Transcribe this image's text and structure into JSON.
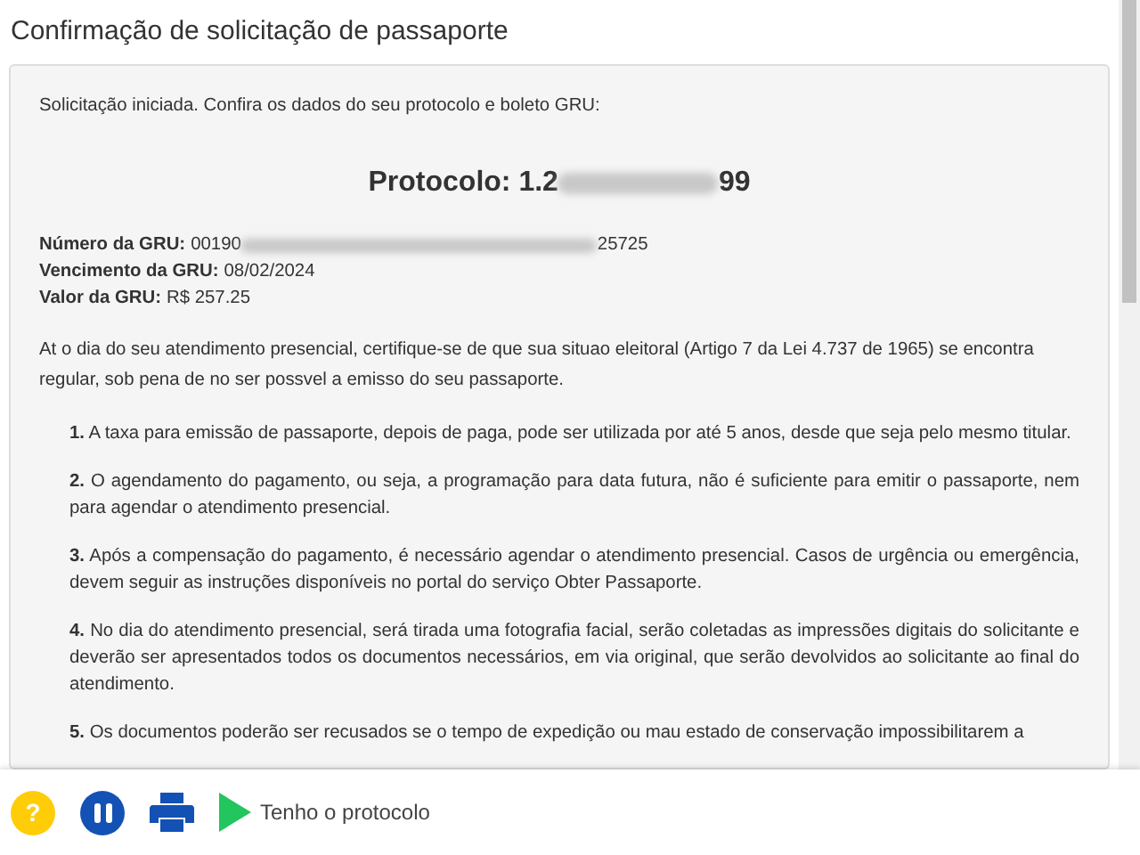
{
  "title": "Confirmação de solicitação de passaporte",
  "intro": "Solicitação iniciada. Confira os dados do seu protocolo e boleto GRU:",
  "protocol": {
    "start": "Protocolo: 1.2",
    "end": "99"
  },
  "gru": [
    {
      "label": "Número da GRU:",
      "start": "00190",
      "end": "25725"
    },
    {
      "label": "Vencimento da GRU:",
      "start": "08/02/2024"
    },
    {
      "label": "Valor da GRU:",
      "start": "R$ 257.25"
    }
  ],
  "notice": "At o dia do seu atendimento presencial, certifique-se de que sua situao eleitoral (Artigo 7 da Lei 4.737 de 1965) se encontra regular, sob pena de no ser possvel a emisso do seu passaporte.",
  "items": [
    {
      "number": "1.",
      "text": "A taxa para emissão de passaporte, depois de paga, pode ser utilizada por até 5 anos, desde que seja pelo mesmo titular."
    },
    {
      "number": "2.",
      "text": "O agendamento do pagamento, ou seja, a programação para data futura, não é suficiente para emitir o passaporte, nem para agendar o atendimento presencial."
    },
    {
      "number": "3.",
      "text": "Após a compensação do pagamento, é necessário agendar o atendimento presencial. Casos de urgência ou emergência, devem seguir as instruções disponíveis no portal do serviço Obter Passaporte."
    },
    {
      "number": "4.",
      "text": "No dia do atendimento presencial, será tirada uma fotografia facial, serão coletadas as impressões digitais do solicitante e deverão ser apresentados todos os documentos necessários, em via original, que serão devolvidos ao solicitante ao final do atendimento."
    },
    {
      "number": "5.",
      "text": "Os documentos poderão ser recusados se o tempo de expedição ou mau estado de conservação impossibilitarem a"
    }
  ],
  "footer": {
    "help": "?",
    "action": "Tenho o protocolo"
  }
}
